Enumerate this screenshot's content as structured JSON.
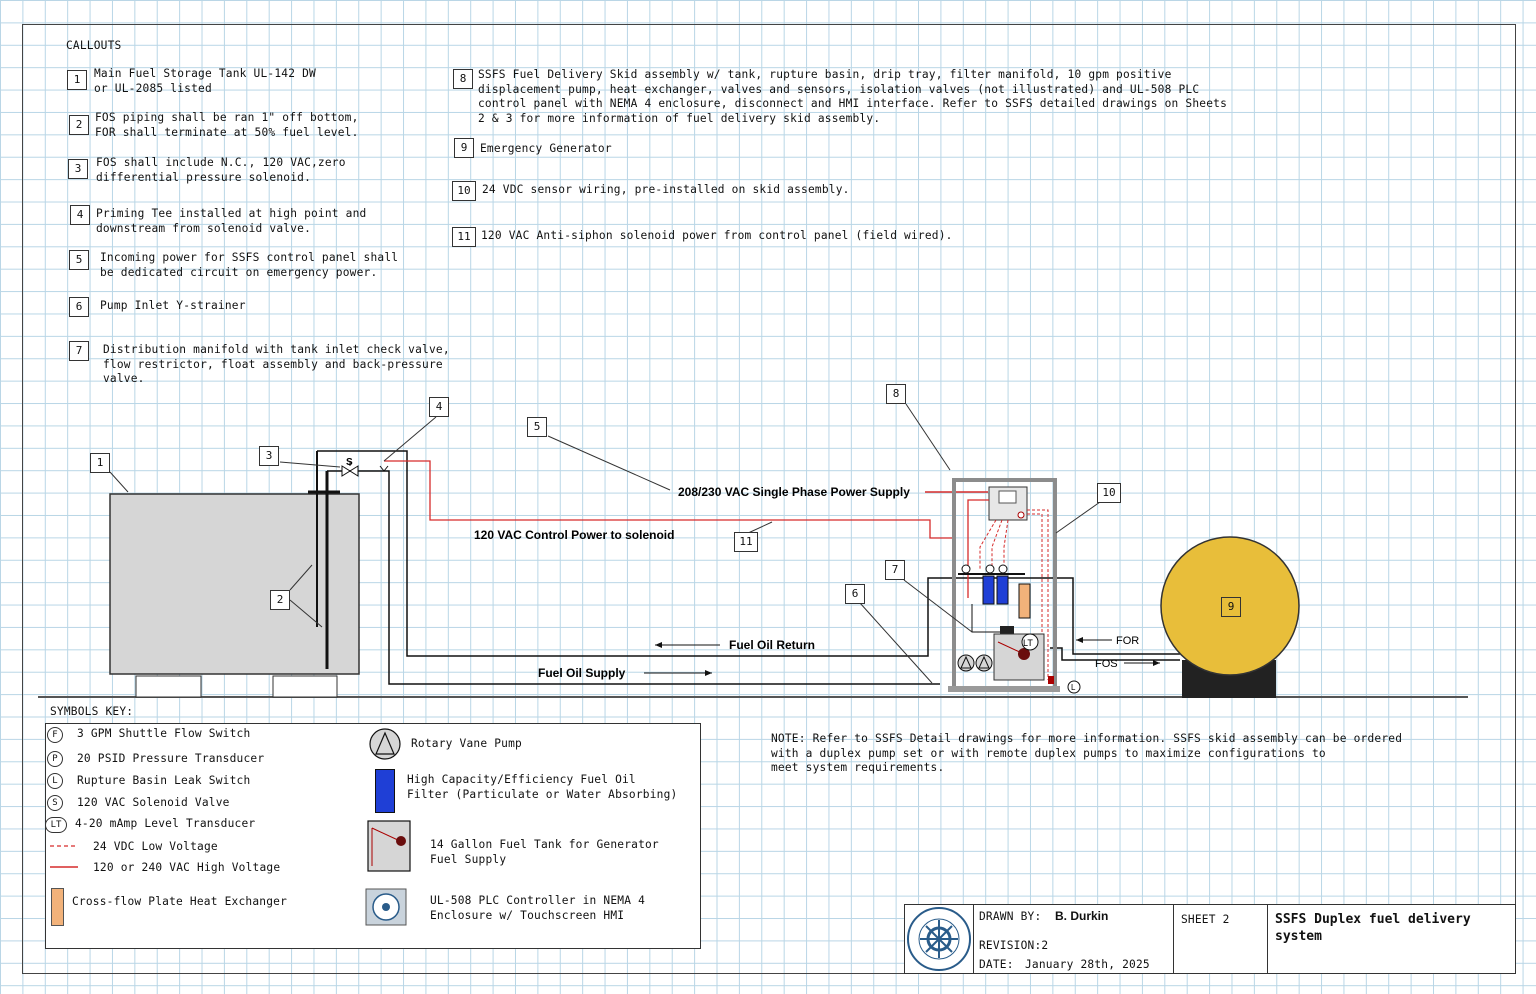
{
  "callouts_title": "CALLOUTS",
  "callouts": [
    {
      "num": "1",
      "text": "Main Fuel Storage Tank UL-142 DW\nor UL-2085 listed"
    },
    {
      "num": "2",
      "text": "FOS piping shall be ran 1\" off bottom,\nFOR shall terminate at 50% fuel level."
    },
    {
      "num": "3",
      "text": "FOS shall include N.C., 120 VAC,zero\ndifferential pressure solenoid."
    },
    {
      "num": "4",
      "text": "Priming Tee installed at high point and\ndownstream from solenoid valve."
    },
    {
      "num": "5",
      "text": "Incoming power for SSFS control panel shall\nbe dedicated circuit on emergency power."
    },
    {
      "num": "6",
      "text": "Pump Inlet Y-strainer"
    },
    {
      "num": "7",
      "text": "Distribution manifold with tank inlet check valve,\nflow restrictor, float assembly and back-pressure\nvalve."
    },
    {
      "num": "8",
      "text": "SSFS Fuel Delivery Skid assembly w/ tank, rupture basin, drip tray, filter manifold, 10 gpm positive\ndisplacement pump, heat exchanger, valves and sensors, isolation valves (not illustrated) and UL-508 PLC\ncontrol panel with NEMA 4 enclosure, disconnect and HMI interface. Refer to SSFS detailed drawings on Sheets\n2 & 3 for more information of fuel delivery skid assembly."
    },
    {
      "num": "9",
      "text": "Emergency Generator"
    },
    {
      "num": "10",
      "text": "24 VDC sensor wiring, pre-installed on skid assembly."
    },
    {
      "num": "11",
      "text": "120 VAC Anti-siphon solenoid power from control panel (field wired)."
    }
  ],
  "diagram": {
    "power_supply_label": "208/230 VAC Single Phase Power Supply",
    "control_power_label": "120 VAC Control Power to solenoid",
    "fuel_return_label": "Fuel Oil Return",
    "fuel_supply_label": "Fuel Oil Supply",
    "for_label": "FOR",
    "fos_label": "FOS",
    "solenoid_symbol": "S",
    "lt_symbol": "LT",
    "leak_symbol": "L",
    "flow_symbol": "F",
    "pressure_symbol": "P",
    "markers": [
      "1",
      "2",
      "3",
      "4",
      "5",
      "6",
      "7",
      "8",
      "9",
      "10",
      "11"
    ],
    "colors": {
      "high_voltage": "#d62b2b",
      "low_voltage": "#d62b2b",
      "generator": "#e8be3a",
      "filter": "#1f3fd6",
      "heat_exchanger": "#f2b27a"
    }
  },
  "symbols_key": {
    "title": "SYMBOLS KEY:",
    "left": [
      {
        "symbol": "F",
        "label": "3 GPM Shuttle Flow Switch"
      },
      {
        "symbol": "P",
        "label": "20 PSID Pressure Transducer"
      },
      {
        "symbol": "L",
        "label": "Rupture Basin Leak Switch"
      },
      {
        "symbol": "S",
        "label": "120 VAC Solenoid Valve"
      },
      {
        "symbol": "LT",
        "label": "4-20 mAmp Level Transducer"
      },
      {
        "symbol": "dashed-red-line",
        "label": "24 VDC Low Voltage"
      },
      {
        "symbol": "solid-red-line",
        "label": "120 or 240 VAC High Voltage"
      },
      {
        "symbol": "heat-exchanger",
        "label": "Cross-flow Plate Heat Exchanger"
      }
    ],
    "right": [
      {
        "symbol": "pump",
        "label": "Rotary Vane Pump"
      },
      {
        "symbol": "filter",
        "label": "High Capacity/Efficiency Fuel Oil\nFilter (Particulate or Water Absorbing)"
      },
      {
        "symbol": "tank",
        "label": "14 Gallon Fuel Tank for Generator\nFuel Supply"
      },
      {
        "symbol": "controller",
        "label": "UL-508 PLC Controller in NEMA 4\nEnclosure w/ Touchscreen HMI"
      }
    ]
  },
  "note": "NOTE: Refer to SSFS Detail drawings for more information. SSFS skid assembly can be ordered\nwith a duplex pump set or with remote duplex pumps to maximize configurations to\nmeet system requirements.",
  "title_block": {
    "drawn_by_label": "DRAWN BY:",
    "drawn_by": "B. Durkin",
    "revision": "REVISION:2",
    "date_label": "DATE:",
    "date": "January 28th, 2025",
    "sheet": "SHEET 2",
    "title": "SSFS Duplex fuel delivery\nsystem",
    "logo_text": "STEADY STATE FUEL SYSTEMS"
  }
}
